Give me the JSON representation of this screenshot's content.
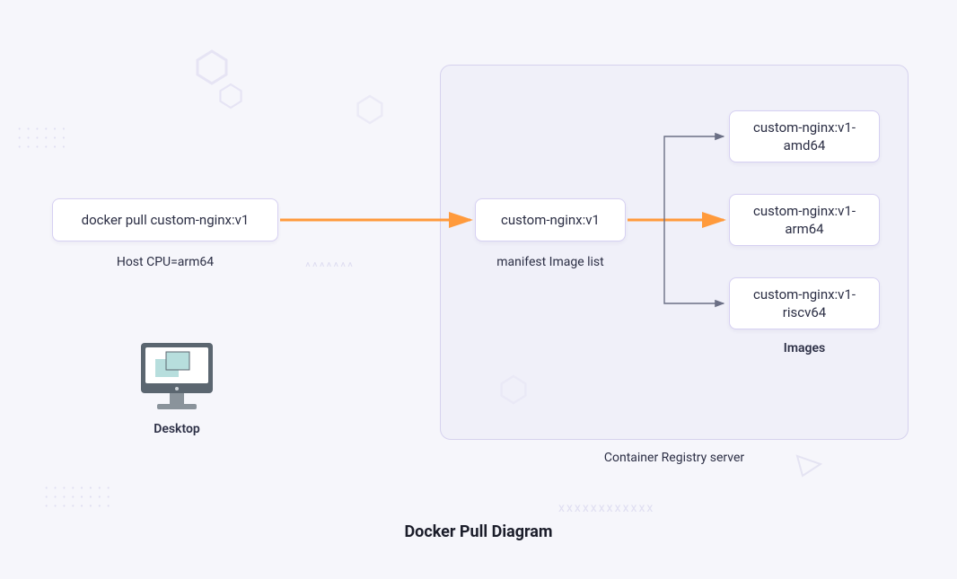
{
  "title": "Docker Pull Diagram",
  "host": {
    "command": "docker pull custom-nginx:v1",
    "cpu_label": "Host CPU=arm64",
    "desktop_label": "Desktop"
  },
  "registry": {
    "label": "Container Registry server",
    "manifest": {
      "name": "custom-nginx:v1",
      "label": "manifest Image list"
    },
    "images": {
      "label": "Images",
      "items": [
        "custom-nginx:v1-amd64",
        "custom-nginx:v1-arm64",
        "custom-nginx:v1-riscv64"
      ]
    }
  },
  "colors": {
    "accent_arrow": "#ff9a3c",
    "node_border": "#d6d0f2",
    "hex": "#d9d6f0"
  }
}
